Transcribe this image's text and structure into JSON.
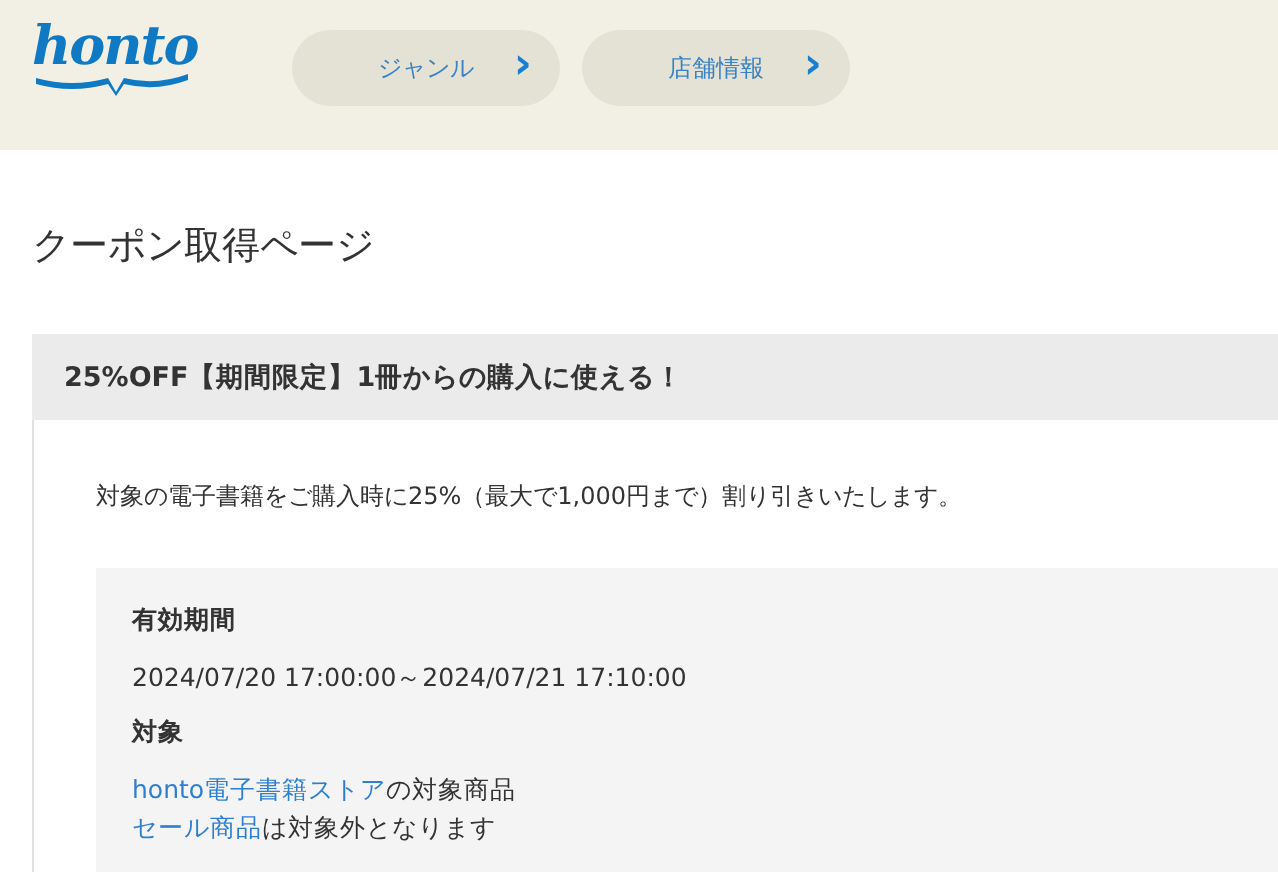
{
  "header": {
    "logo": "honto",
    "nav": [
      {
        "label": "ジャンル",
        "arrow": "›"
      },
      {
        "label": "店舗情報",
        "arrow": "›"
      }
    ]
  },
  "page_title": "クーポン取得ページ",
  "coupon": {
    "heading": "25%OFF【期間限定】1冊からの購入に使える！",
    "description": "対象の電子書籍をご購入時に25%（最大で1,000円まで）割り引きいたします。",
    "details": [
      {
        "label": "有効期間",
        "lines": [
          [
            {
              "text": "2024/07/20 17:00:00～2024/07/21 17:10:00",
              "link": false
            }
          ]
        ]
      },
      {
        "label": "対象",
        "lines": [
          [
            {
              "text": "honto電子書籍ストア",
              "link": true
            },
            {
              "text": "の対象商品",
              "link": false
            }
          ],
          [
            {
              "text": "セール商品",
              "link": true
            },
            {
              "text": "は対象外となります",
              "link": false
            }
          ]
        ]
      }
    ]
  }
}
